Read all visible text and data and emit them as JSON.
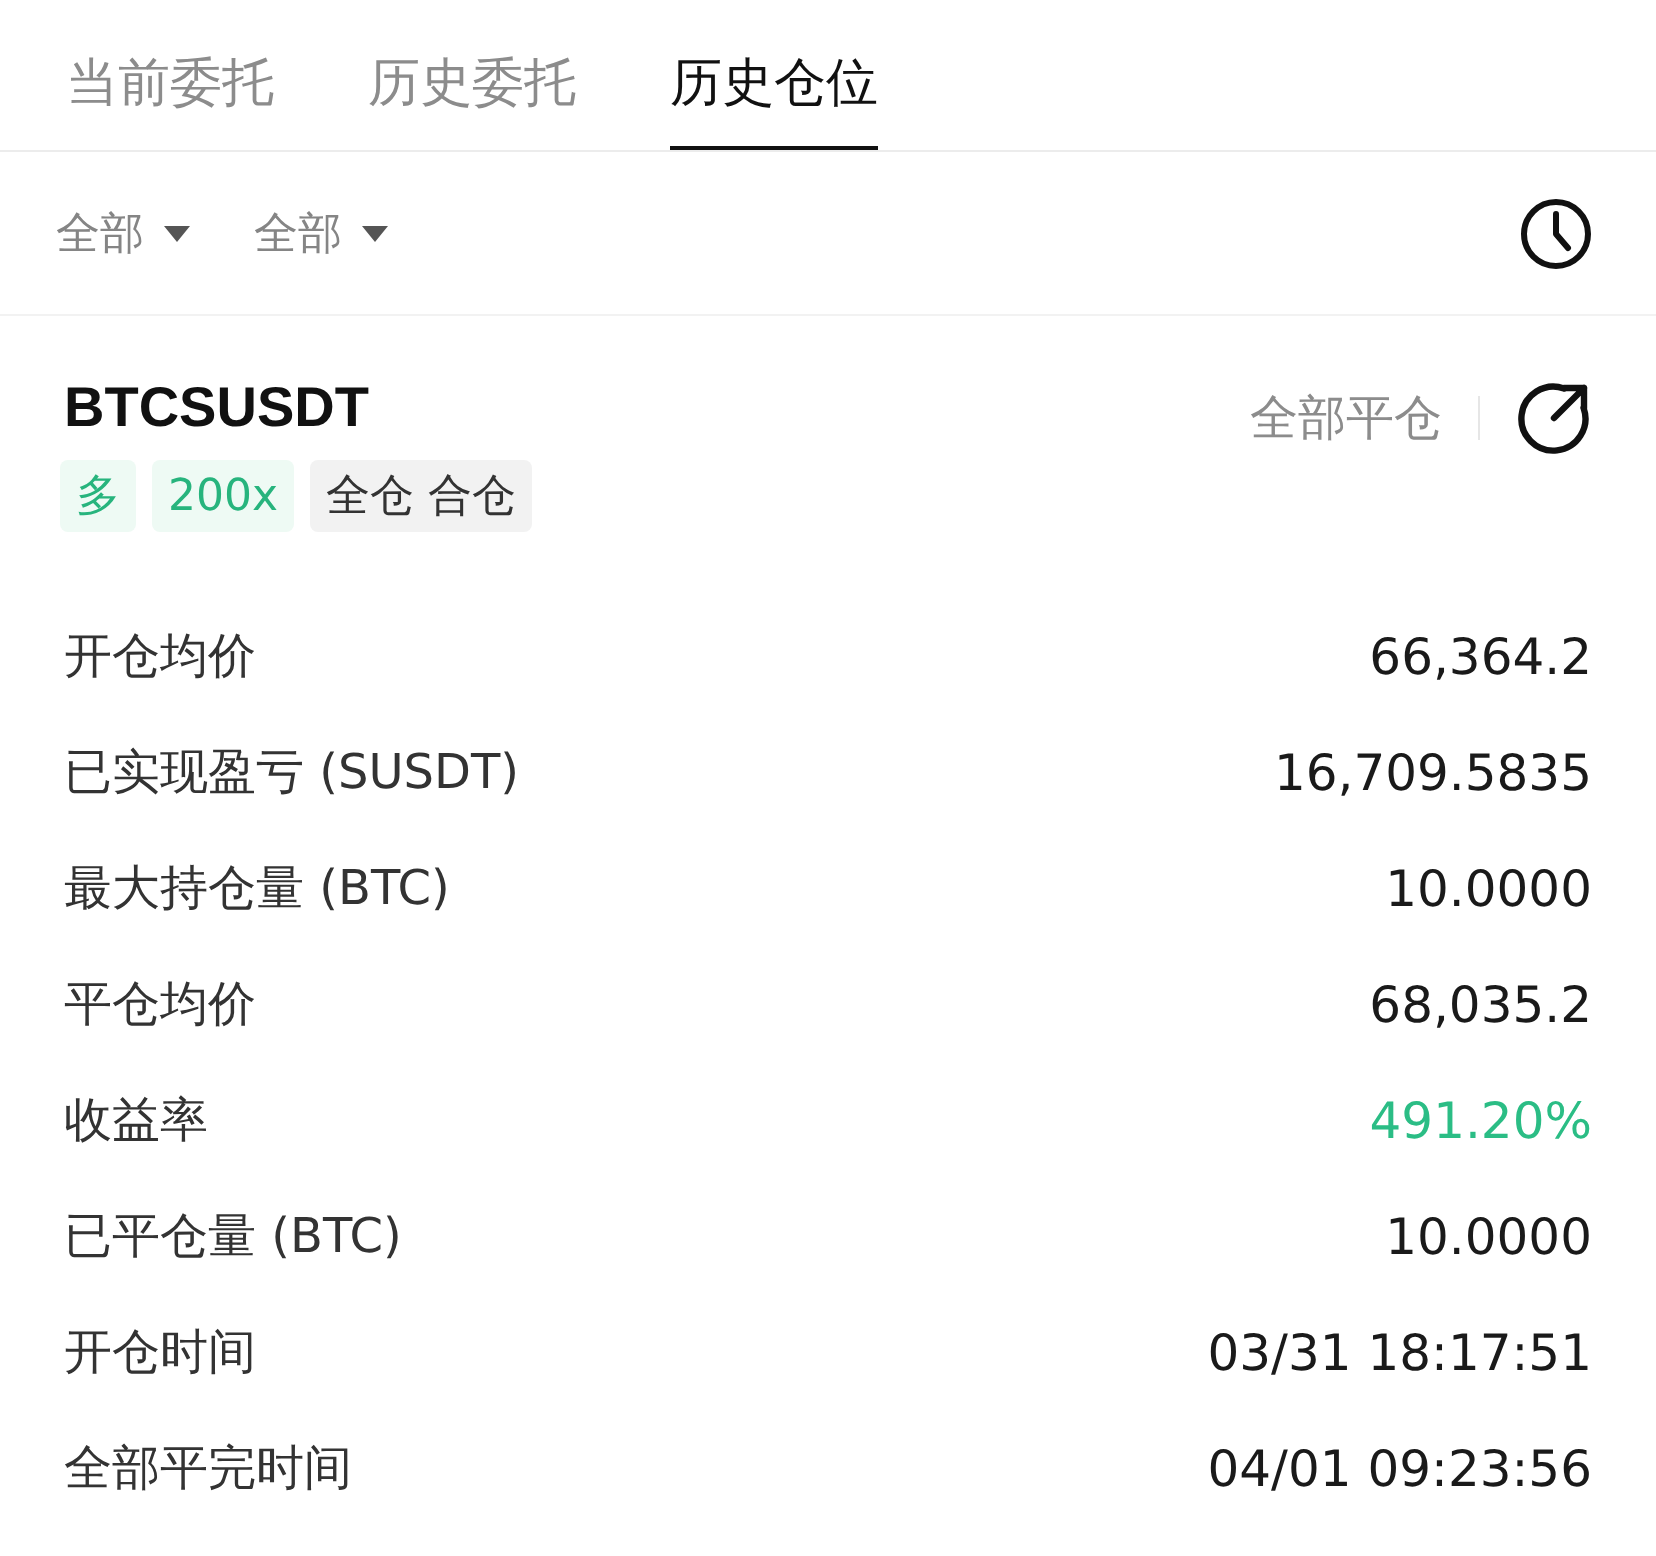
{
  "tabs": [
    {
      "label": "当前委托",
      "selected": false
    },
    {
      "label": "历史委托",
      "selected": false
    },
    {
      "label": "历史仓位",
      "selected": true
    }
  ],
  "filters": [
    {
      "label": "全部"
    },
    {
      "label": "全部"
    }
  ],
  "position": {
    "symbol": "BTCSUSDT",
    "tags": [
      {
        "label": "多",
        "kind": "accent"
      },
      {
        "label": "200x",
        "kind": "accent"
      },
      {
        "label": "全仓 合仓",
        "kind": "plain"
      }
    ],
    "close_all": "全部平仓",
    "fields": [
      {
        "label": "开仓均价",
        "value": "66,364.2",
        "positive": false
      },
      {
        "label": "已实现盈亏 (SUSDT)",
        "value": "16,709.5835",
        "positive": false
      },
      {
        "label": "最大持仓量 (BTC)",
        "value": "10.0000",
        "positive": false
      },
      {
        "label": "平仓均价",
        "value": "68,035.2",
        "positive": false
      },
      {
        "label": "收益率",
        "value": "491.20%",
        "positive": true
      },
      {
        "label": "已平仓量 (BTC)",
        "value": "10.0000",
        "positive": false
      },
      {
        "label": "开仓时间",
        "value": "03/31 18:17:51",
        "positive": false
      },
      {
        "label": "全部平完时间",
        "value": "04/01 09:23:56",
        "positive": false
      }
    ]
  }
}
